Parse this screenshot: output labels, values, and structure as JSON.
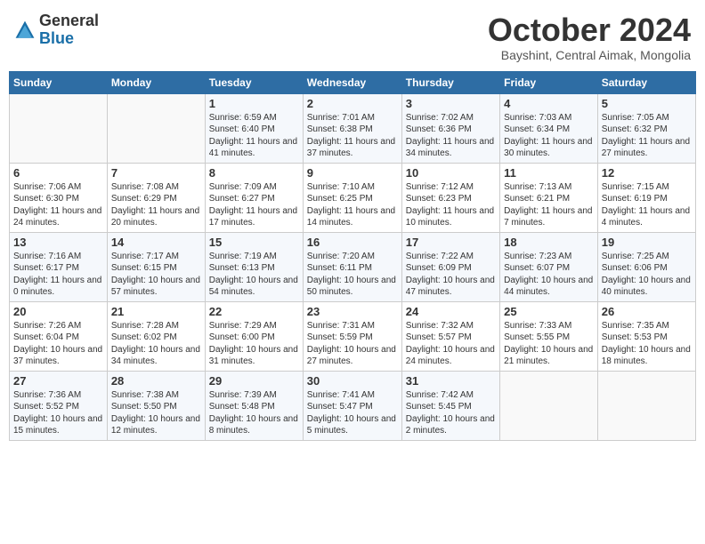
{
  "logo": {
    "general": "General",
    "blue": "Blue"
  },
  "header": {
    "month": "October 2024",
    "location": "Bayshint, Central Aimak, Mongolia"
  },
  "weekdays": [
    "Sunday",
    "Monday",
    "Tuesday",
    "Wednesday",
    "Thursday",
    "Friday",
    "Saturday"
  ],
  "weeks": [
    [
      {
        "day": "",
        "info": ""
      },
      {
        "day": "",
        "info": ""
      },
      {
        "day": "1",
        "info": "Sunrise: 6:59 AM\nSunset: 6:40 PM\nDaylight: 11 hours and 41 minutes."
      },
      {
        "day": "2",
        "info": "Sunrise: 7:01 AM\nSunset: 6:38 PM\nDaylight: 11 hours and 37 minutes."
      },
      {
        "day": "3",
        "info": "Sunrise: 7:02 AM\nSunset: 6:36 PM\nDaylight: 11 hours and 34 minutes."
      },
      {
        "day": "4",
        "info": "Sunrise: 7:03 AM\nSunset: 6:34 PM\nDaylight: 11 hours and 30 minutes."
      },
      {
        "day": "5",
        "info": "Sunrise: 7:05 AM\nSunset: 6:32 PM\nDaylight: 11 hours and 27 minutes."
      }
    ],
    [
      {
        "day": "6",
        "info": "Sunrise: 7:06 AM\nSunset: 6:30 PM\nDaylight: 11 hours and 24 minutes."
      },
      {
        "day": "7",
        "info": "Sunrise: 7:08 AM\nSunset: 6:29 PM\nDaylight: 11 hours and 20 minutes."
      },
      {
        "day": "8",
        "info": "Sunrise: 7:09 AM\nSunset: 6:27 PM\nDaylight: 11 hours and 17 minutes."
      },
      {
        "day": "9",
        "info": "Sunrise: 7:10 AM\nSunset: 6:25 PM\nDaylight: 11 hours and 14 minutes."
      },
      {
        "day": "10",
        "info": "Sunrise: 7:12 AM\nSunset: 6:23 PM\nDaylight: 11 hours and 10 minutes."
      },
      {
        "day": "11",
        "info": "Sunrise: 7:13 AM\nSunset: 6:21 PM\nDaylight: 11 hours and 7 minutes."
      },
      {
        "day": "12",
        "info": "Sunrise: 7:15 AM\nSunset: 6:19 PM\nDaylight: 11 hours and 4 minutes."
      }
    ],
    [
      {
        "day": "13",
        "info": "Sunrise: 7:16 AM\nSunset: 6:17 PM\nDaylight: 11 hours and 0 minutes."
      },
      {
        "day": "14",
        "info": "Sunrise: 7:17 AM\nSunset: 6:15 PM\nDaylight: 10 hours and 57 minutes."
      },
      {
        "day": "15",
        "info": "Sunrise: 7:19 AM\nSunset: 6:13 PM\nDaylight: 10 hours and 54 minutes."
      },
      {
        "day": "16",
        "info": "Sunrise: 7:20 AM\nSunset: 6:11 PM\nDaylight: 10 hours and 50 minutes."
      },
      {
        "day": "17",
        "info": "Sunrise: 7:22 AM\nSunset: 6:09 PM\nDaylight: 10 hours and 47 minutes."
      },
      {
        "day": "18",
        "info": "Sunrise: 7:23 AM\nSunset: 6:07 PM\nDaylight: 10 hours and 44 minutes."
      },
      {
        "day": "19",
        "info": "Sunrise: 7:25 AM\nSunset: 6:06 PM\nDaylight: 10 hours and 40 minutes."
      }
    ],
    [
      {
        "day": "20",
        "info": "Sunrise: 7:26 AM\nSunset: 6:04 PM\nDaylight: 10 hours and 37 minutes."
      },
      {
        "day": "21",
        "info": "Sunrise: 7:28 AM\nSunset: 6:02 PM\nDaylight: 10 hours and 34 minutes."
      },
      {
        "day": "22",
        "info": "Sunrise: 7:29 AM\nSunset: 6:00 PM\nDaylight: 10 hours and 31 minutes."
      },
      {
        "day": "23",
        "info": "Sunrise: 7:31 AM\nSunset: 5:59 PM\nDaylight: 10 hours and 27 minutes."
      },
      {
        "day": "24",
        "info": "Sunrise: 7:32 AM\nSunset: 5:57 PM\nDaylight: 10 hours and 24 minutes."
      },
      {
        "day": "25",
        "info": "Sunrise: 7:33 AM\nSunset: 5:55 PM\nDaylight: 10 hours and 21 minutes."
      },
      {
        "day": "26",
        "info": "Sunrise: 7:35 AM\nSunset: 5:53 PM\nDaylight: 10 hours and 18 minutes."
      }
    ],
    [
      {
        "day": "27",
        "info": "Sunrise: 7:36 AM\nSunset: 5:52 PM\nDaylight: 10 hours and 15 minutes."
      },
      {
        "day": "28",
        "info": "Sunrise: 7:38 AM\nSunset: 5:50 PM\nDaylight: 10 hours and 12 minutes."
      },
      {
        "day": "29",
        "info": "Sunrise: 7:39 AM\nSunset: 5:48 PM\nDaylight: 10 hours and 8 minutes."
      },
      {
        "day": "30",
        "info": "Sunrise: 7:41 AM\nSunset: 5:47 PM\nDaylight: 10 hours and 5 minutes."
      },
      {
        "day": "31",
        "info": "Sunrise: 7:42 AM\nSunset: 5:45 PM\nDaylight: 10 hours and 2 minutes."
      },
      {
        "day": "",
        "info": ""
      },
      {
        "day": "",
        "info": ""
      }
    ]
  ]
}
